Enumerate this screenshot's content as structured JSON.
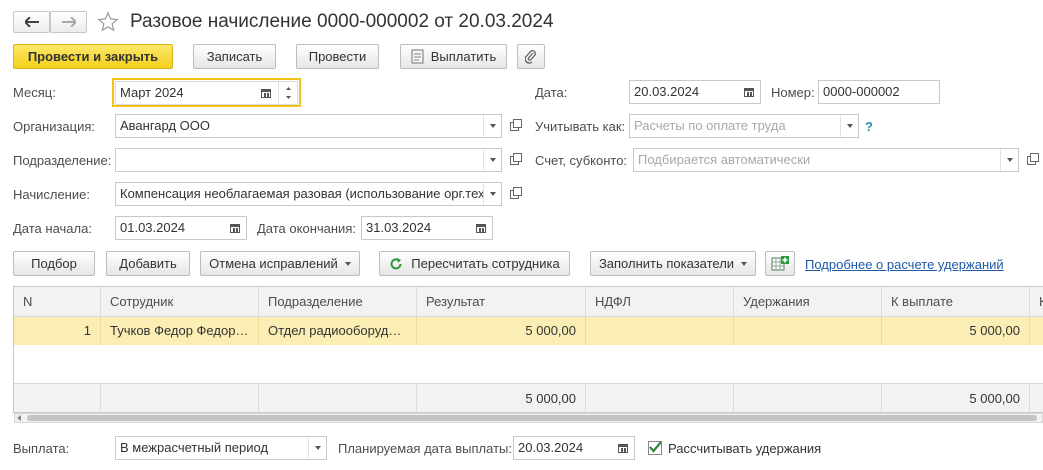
{
  "window": {
    "title": "Разовое начисление 0000-000002 от 20.03.2024"
  },
  "toolbar": {
    "post_close": "Провести и закрыть",
    "save": "Записать",
    "post": "Провести",
    "pay": "Выплатить"
  },
  "form": {
    "month_label": "Месяц:",
    "month_value": "Март 2024",
    "date_label": "Дата:",
    "date_value": "20.03.2024",
    "number_label": "Номер:",
    "number_value": "0000-000002",
    "org_label": "Организация:",
    "org_value": "Авангард ООО",
    "account_as_label": "Учитывать как:",
    "account_as_placeholder": "Расчеты по оплате труда",
    "help": "?",
    "dept_label": "Подразделение:",
    "dept_value": "",
    "subconto_label": "Счет, субконто:",
    "subconto_placeholder": "Подбирается автоматически",
    "accrual_label": "Начисление:",
    "accrual_value": "Компенсация необлагаемая разовая (использование орг.техники)",
    "start_label": "Дата начала:",
    "start_value": "01.03.2024",
    "end_label": "Дата окончания:",
    "end_value": "31.03.2024"
  },
  "table_toolbar": {
    "pick": "Подбор",
    "add": "Добавить",
    "cancel_corrections": "Отмена исправлений",
    "recalc": "Пересчитать сотрудника",
    "fill": "Заполнить показатели",
    "details_link": "Подробнее о расчете удержаний"
  },
  "table": {
    "columns": [
      "N",
      "Сотрудник",
      "Подразделение",
      "Результат",
      "НДФЛ",
      "Удержания",
      "К выплате",
      "К"
    ],
    "rows": [
      [
        "1",
        "Тучков Федор Федорович",
        "Отдел радиооборудования",
        "5 000,00",
        "",
        "",
        "5 000,00",
        ""
      ]
    ],
    "totals": {
      "result": "5 000,00",
      "payout": "5 000,00"
    }
  },
  "footer": {
    "payment_label": "Выплата:",
    "payment_value": "В межрасчетный период",
    "planned_label": "Планируемая дата выплаты:",
    "planned_value": "20.03.2024",
    "calc_deductions_label": "Рассчитывать удержания",
    "calc_deductions_checked": true
  },
  "colors": {
    "primary_button": "#f5cf1c",
    "selected_row": "#fbeeb4",
    "focus_border": "#f0c419",
    "link": "#1f5aa8",
    "check": "#2e8b3a"
  }
}
